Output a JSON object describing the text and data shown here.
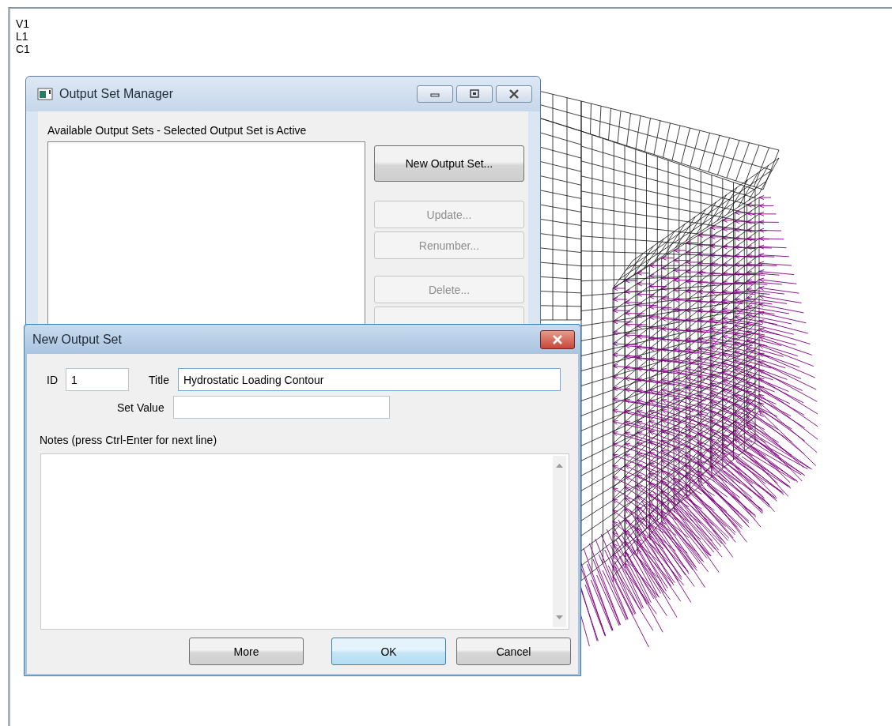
{
  "viewport": {
    "labels": [
      "V1",
      "L1",
      "C1"
    ]
  },
  "output_set_manager": {
    "title": "Output Set Manager",
    "list_label": "Available Output Sets - Selected Output Set is Active",
    "buttons": [
      {
        "label": "New Output Set...",
        "disabled": false
      },
      {
        "label": "Update...",
        "disabled": true
      },
      {
        "label": "Renumber...",
        "disabled": true
      },
      {
        "label": "Delete...",
        "disabled": true
      }
    ]
  },
  "new_output_set": {
    "title": "New Output Set",
    "id": {
      "label": "ID",
      "value": "1"
    },
    "title_field": {
      "label": "Title",
      "value": "Hydrostatic Loading Contour"
    },
    "set_value": {
      "label": "Set Value"
    },
    "notes": {
      "label": "Notes (press Ctrl-Enter for next line)"
    },
    "buttons": [
      {
        "label": "More",
        "default": false
      },
      {
        "label": "OK",
        "default": true
      },
      {
        "label": "Cancel",
        "default": false
      }
    ]
  }
}
